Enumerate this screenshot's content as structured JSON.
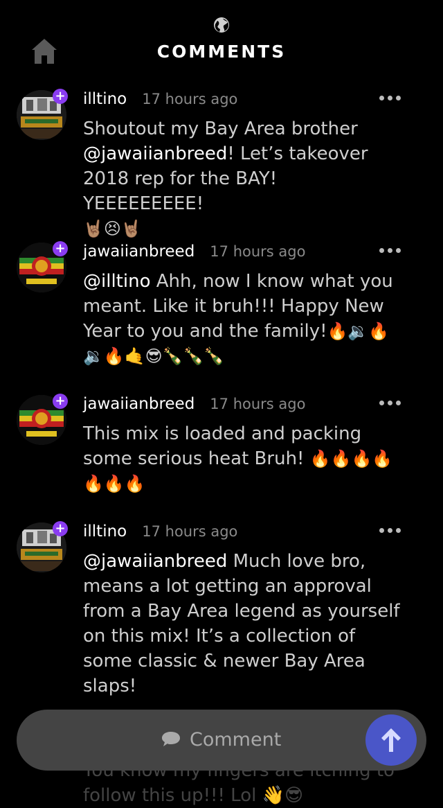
{
  "header": {
    "title": "COMMENTS"
  },
  "comments": [
    {
      "username": "illtino",
      "time": "17 hours ago",
      "avatar": "illtino",
      "mention": "",
      "text_before": "Shoutout my Bay Area brother ",
      "inline_mention": "@jawaiianbreed",
      "text_after": "! Let’s takeover 2018 rep for the BAY! YEEEEEEEEE!",
      "emoji": "🤘🏽😣🤘🏽"
    },
    {
      "username": "jawaiianbreed",
      "time": "17 hours ago",
      "avatar": "jawaiianbreed",
      "mention": "@illtino",
      "text_before": " Ahh, now I know what you meant. Like it bruh!!! Happy New Year to you and the family!",
      "inline_mention": "",
      "text_after": "",
      "emoji": "🔥🔉🔥🔉🔥🤙😎🍾🍾🍾"
    },
    {
      "username": "jawaiianbreed",
      "time": "17 hours ago",
      "avatar": "jawaiianbreed",
      "mention": "",
      "text_before": "This mix is loaded and packing some serious heat Bruh! ",
      "inline_mention": "",
      "text_after": "",
      "emoji": "🔥🔥🔥🔥🔥🔥🔥"
    },
    {
      "username": "illtino",
      "time": "17 hours ago",
      "avatar": "illtino",
      "mention": "@jawaiianbreed",
      "text_before": " Much love bro, means a lot getting an approval from a Bay Area legend as yourself on this mix! It’s a collection of some classic & newer Bay Area slaps!",
      "inline_mention": "",
      "text_after": "",
      "emoji": ""
    }
  ],
  "peek_text": "You know my fingers are itching to follow this up!!! Lol 👋😎",
  "composer": {
    "label": "Comment"
  },
  "icons": {
    "home": "home-icon",
    "globe": "globe-icon",
    "more": "more-dots-icon",
    "comment_bubble": "chat-bubble-icon",
    "send": "arrow-up-icon"
  },
  "colors": {
    "background": "#000000",
    "plus_badge": "#8a3cf0",
    "send_button": "#4a56c8",
    "composer_bar": "#444444",
    "body_text": "#cfcfcf",
    "time_text": "#8a8a8a"
  }
}
